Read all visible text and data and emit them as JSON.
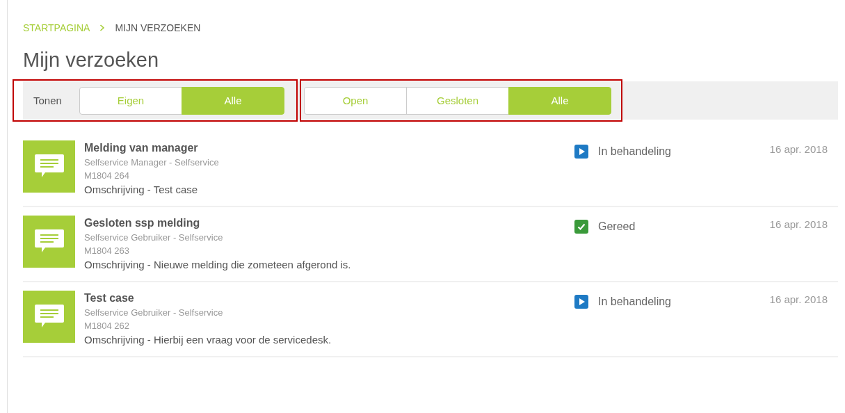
{
  "breadcrumb": [
    {
      "label": "STARTPAGINA",
      "current": false
    },
    {
      "label": "MIJN VERZOEKEN",
      "current": true
    }
  ],
  "title": "Mijn verzoeken",
  "filters": [
    {
      "label": "Tonen",
      "highlighted": true,
      "options": [
        {
          "label": "Eigen",
          "selected": false
        },
        {
          "label": "Alle",
          "selected": true
        }
      ]
    },
    {
      "highlighted": true,
      "options": [
        {
          "label": "Open",
          "selected": false
        },
        {
          "label": "Gesloten",
          "selected": false
        },
        {
          "label": "Alle",
          "selected": true
        }
      ]
    }
  ],
  "requests": [
    {
      "title": "Melding van manager",
      "requester": "Selfservice Manager - Selfservice",
      "number": "M1804 264",
      "description": "Omschrijving - Test case",
      "status": {
        "kind": "in_progress",
        "label": "In behandeling"
      },
      "date": "16 apr. 2018"
    },
    {
      "title": "Gesloten ssp melding",
      "requester": "Selfservice Gebruiker - Selfservice",
      "number": "M1804 263",
      "description": "Omschrijving - Nieuwe melding die zometeen afgerond is.",
      "status": {
        "kind": "done",
        "label": "Gereed"
      },
      "date": "16 apr. 2018"
    },
    {
      "title": "Test case",
      "requester": "Selfservice Gebruiker - Selfservice",
      "number": "M1804 262",
      "description": "Omschrijving - Hierbij een vraag voor de servicedesk.",
      "status": {
        "kind": "in_progress",
        "label": "In behandeling"
      },
      "date": "16 apr. 2018"
    }
  ]
}
